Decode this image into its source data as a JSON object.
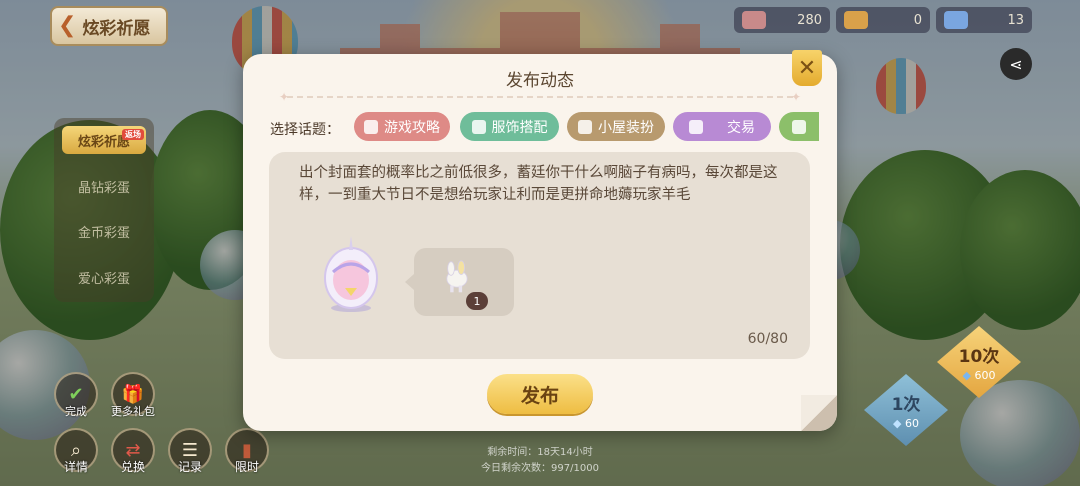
{
  "header": {
    "back_label": "炫彩祈愿"
  },
  "resources": [
    {
      "icon": "ticket-icon",
      "value": "280",
      "color": "#c98a8a"
    },
    {
      "icon": "key-icon",
      "value": "0",
      "color": "#d9a14a"
    },
    {
      "icon": "sparkle-gem-icon",
      "value": "13",
      "color": "#7aa6e0"
    }
  ],
  "side_menu": {
    "tag": "返场",
    "items": [
      "炫彩祈愿",
      "晶钻彩蛋",
      "金币彩蛋",
      "爱心彩蛋"
    ]
  },
  "bottom_buttons": {
    "check_label": "完成",
    "gift_label": "更多礼包",
    "details_label": "详情",
    "exchange_label": "兑换",
    "record_label": "记录",
    "limited_label": "限时"
  },
  "gacha": {
    "ten": {
      "count": "10次",
      "cost": "600"
    },
    "one": {
      "count": "1次",
      "cost": "60"
    }
  },
  "bottom_info": {
    "time_remaining": "剩余时间：18天14小时",
    "daily_remaining": "今日剩余次数：997/1000"
  },
  "dialog": {
    "title": "发布动态",
    "topic_label": "选择话题：",
    "topics": [
      {
        "label": "游戏攻略",
        "color": "#de8a86"
      },
      {
        "label": "服饰搭配",
        "color": "#6fbd9a"
      },
      {
        "label": "小屋装扮",
        "color": "#b89a6e"
      },
      {
        "label": "交易",
        "color": "#b88ad4"
      },
      {
        "label": "",
        "color": "#8cbf6a"
      }
    ],
    "message": "出个封面套的概率比之前低很多，蓄廷你干什么啊脑子有病吗，每次都是这样，一到重大节日不是想给玩家让利而是更拼命地薅玩家羊毛",
    "counter": "60/80",
    "item_quantity": "1",
    "publish_label": "发布"
  },
  "colors": {
    "accent": "#eebd42",
    "dialog_bg": "#faf4ec",
    "textbox_bg": "#e7dfd4"
  }
}
